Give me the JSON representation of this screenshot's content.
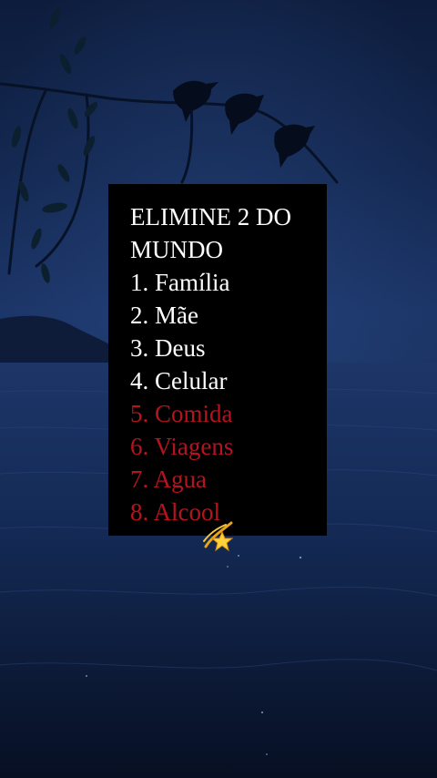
{
  "post": {
    "title": "ELIMINE 2 DO MUNDO",
    "items": [
      {
        "text": "1. Família",
        "color": "#ffffff"
      },
      {
        "text": "2. Mãe",
        "color": "#ffffff"
      },
      {
        "text": "3. Deus",
        "color": "#ffffff"
      },
      {
        "text": "4. Celular",
        "color": "#ffffff"
      },
      {
        "text": "5. Comida",
        "color": "#b5141f"
      },
      {
        "text": "6. Viagens",
        "color": "#b5141f"
      },
      {
        "text": "7. Agua",
        "color": "#b5141f"
      },
      {
        "text": "8. Alcool",
        "color": "#b5141f"
      }
    ],
    "emoji_icon": "dizzy-star-emoji",
    "background": "night lake with willow branch and birds"
  }
}
